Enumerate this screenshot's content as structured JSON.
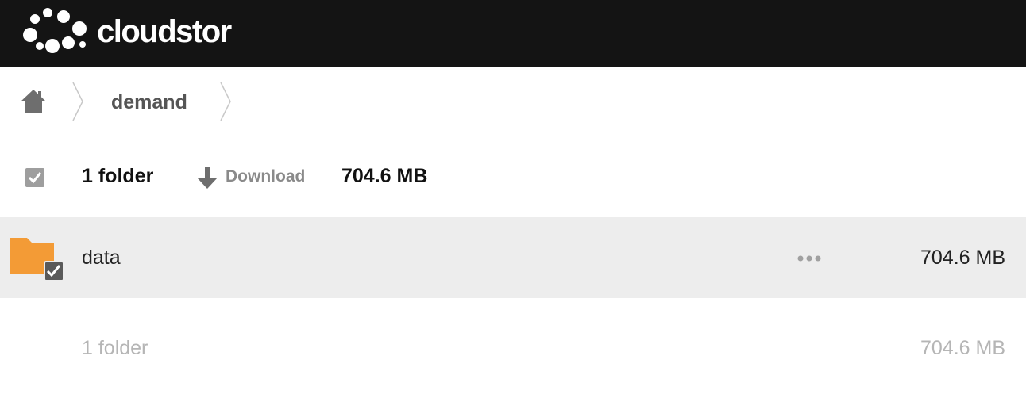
{
  "brand": {
    "name": "cloudstor",
    "header_bg": "#141414",
    "logo_color": "#ffffff"
  },
  "breadcrumb": {
    "home_icon": "home-icon",
    "items": [
      {
        "label": "demand"
      }
    ]
  },
  "toolbar": {
    "select_all_checked": true,
    "selection_count": "1 folder",
    "download_label": "Download",
    "download_icon": "download-arrow-icon",
    "selection_size": "704.6 MB"
  },
  "files": [
    {
      "name": "data",
      "type": "folder",
      "icon": "folder-icon",
      "icon_color": "#f39b36",
      "checked": true,
      "actions_icon": "more-dots-icon",
      "size": "704.6 MB",
      "row_bg": "#ededed"
    }
  ],
  "footer": {
    "count": "1 folder",
    "size": "704.6 MB"
  }
}
